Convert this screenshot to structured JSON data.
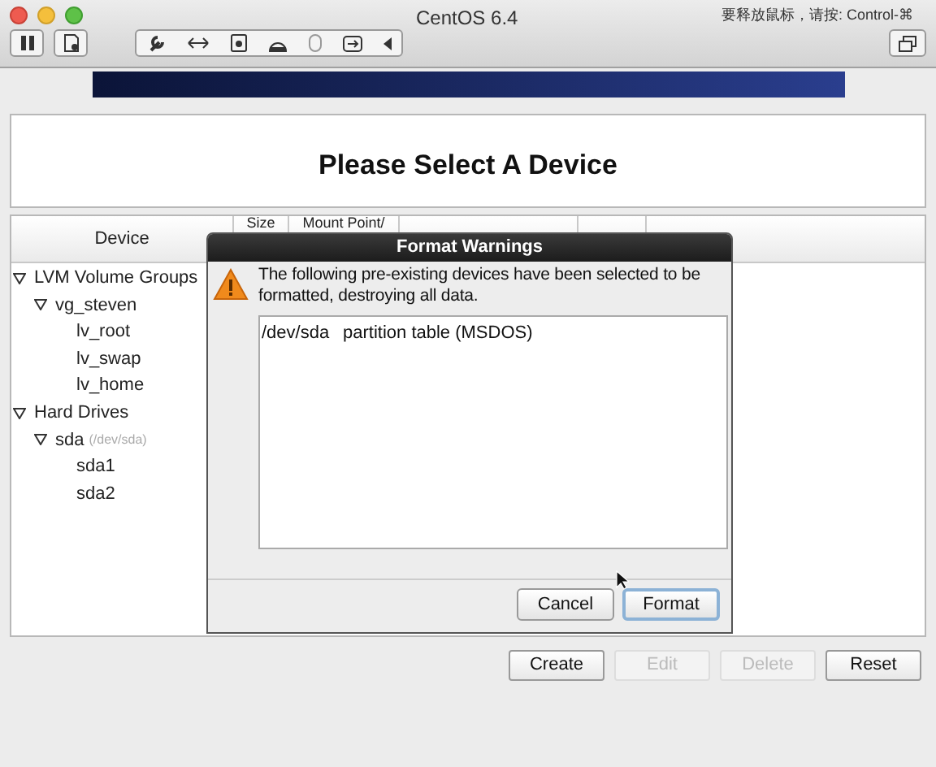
{
  "window": {
    "title": "CentOS 6.4",
    "hint": "要释放鼠标，请按: Control-⌘"
  },
  "header": {
    "title": "Please Select A Device"
  },
  "table": {
    "columns": [
      "Device",
      "Size",
      "Mount Point/"
    ],
    "tree": [
      {
        "label": "LVM Volume Groups",
        "expanded": true,
        "children": [
          {
            "label": "vg_steven",
            "expanded": true,
            "children": [
              {
                "label": "lv_root"
              },
              {
                "label": "lv_swap"
              },
              {
                "label": "lv_home"
              }
            ]
          }
        ]
      },
      {
        "label": "Hard Drives",
        "expanded": true,
        "children": [
          {
            "label": "sda",
            "note": "(/dev/sda)",
            "expanded": true,
            "children": [
              {
                "label": "sda1"
              },
              {
                "label": "sda2"
              }
            ]
          }
        ]
      }
    ]
  },
  "dialog": {
    "title": "Format Warnings",
    "message": "The following pre-existing devices have been selected to be formatted, destroying all data.",
    "items": [
      {
        "device": "/dev/sda",
        "description": "partition table (MSDOS)"
      }
    ],
    "buttons": [
      {
        "label": "Cancel",
        "default": false
      },
      {
        "label": "Format",
        "default": true
      }
    ]
  },
  "buttons": [
    {
      "label": "Create",
      "disabled": false
    },
    {
      "label": "Edit",
      "disabled": true
    },
    {
      "label": "Delete",
      "disabled": true
    },
    {
      "label": "Reset",
      "disabled": false
    }
  ]
}
